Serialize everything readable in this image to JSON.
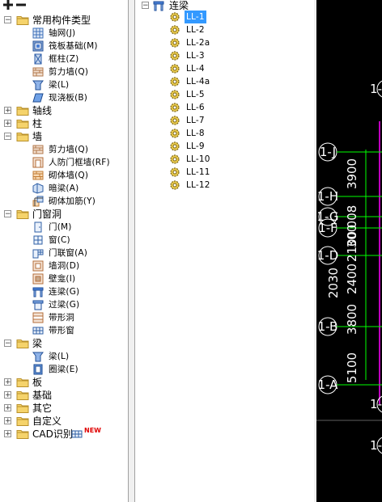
{
  "toolbar": {
    "add_icon": "plus-icon",
    "remove_icon": "minus-icon"
  },
  "left_tree": [
    {
      "label": "常用构件类型",
      "type": "group",
      "expanded": true,
      "children": [
        {
          "label": "轴网(J)",
          "icon": "axis-grid-icon"
        },
        {
          "label": "筏板基础(M)",
          "icon": "raft-foundation-icon"
        },
        {
          "label": "框柱(Z)",
          "icon": "frame-column-icon"
        },
        {
          "label": "剪力墙(Q)",
          "icon": "shear-wall-icon"
        },
        {
          "label": "梁(L)",
          "icon": "beam-icon"
        },
        {
          "label": "现浇板(B)",
          "icon": "slab-icon"
        }
      ]
    },
    {
      "label": "轴线",
      "type": "group",
      "expanded": false
    },
    {
      "label": "柱",
      "type": "group",
      "expanded": false
    },
    {
      "label": "墙",
      "type": "group",
      "expanded": true,
      "children": [
        {
          "label": "剪力墙(Q)",
          "icon": "shear-wall-icon"
        },
        {
          "label": "人防门框墙(RF)",
          "icon": "civil-defense-door-wall-icon"
        },
        {
          "label": "砌体墙(Q)",
          "icon": "masonry-wall-icon"
        },
        {
          "label": "暗梁(A)",
          "icon": "hidden-beam-icon"
        },
        {
          "label": "砌体加筋(Y)",
          "icon": "masonry-reinforcement-icon"
        }
      ]
    },
    {
      "label": "门窗洞",
      "type": "group",
      "expanded": true,
      "children": [
        {
          "label": "门(M)",
          "icon": "door-icon"
        },
        {
          "label": "窗(C)",
          "icon": "window-icon"
        },
        {
          "label": "门联窗(A)",
          "icon": "door-window-icon"
        },
        {
          "label": "墙洞(D)",
          "icon": "wall-opening-icon"
        },
        {
          "label": "壁龛(I)",
          "icon": "niche-icon"
        },
        {
          "label": "连梁(G)",
          "icon": "coupling-beam-icon"
        },
        {
          "label": "过梁(G)",
          "icon": "lintel-icon"
        },
        {
          "label": "带形洞",
          "icon": "strip-opening-icon"
        },
        {
          "label": "带形窗",
          "icon": "strip-window-icon"
        }
      ]
    },
    {
      "label": "梁",
      "type": "group",
      "expanded": true,
      "children": [
        {
          "label": "梁(L)",
          "icon": "beam-icon"
        },
        {
          "label": "圈梁(E)",
          "icon": "ring-beam-icon"
        }
      ]
    },
    {
      "label": "板",
      "type": "group",
      "expanded": false
    },
    {
      "label": "基础",
      "type": "group",
      "expanded": false
    },
    {
      "label": "其它",
      "type": "group",
      "expanded": false
    },
    {
      "label": "自定义",
      "type": "group",
      "expanded": false
    },
    {
      "label": "CAD识别",
      "type": "group",
      "expanded": false,
      "badge": "NEW"
    }
  ],
  "mid_tree": {
    "root_label": "连梁",
    "items": [
      "LL-1",
      "LL-2",
      "LL-2a",
      "LL-3",
      "LL-4",
      "LL-4a",
      "LL-5",
      "LL-6",
      "LL-7",
      "LL-8",
      "LL-9",
      "LL-10",
      "LL-11",
      "LL-12"
    ],
    "selected": "LL-1"
  },
  "cad_view": {
    "axis_labels": [
      "1-J",
      "1-H",
      "1-G",
      "1-F",
      "1-D",
      "1-B",
      "1-A"
    ],
    "dimensions": [
      "3900",
      "008",
      "300",
      "2100",
      "2400",
      "3800",
      "5100",
      "2030"
    ],
    "colors": {
      "background": "#000000",
      "dimension": "#ffffff",
      "grid_line": "#00ff00",
      "accent": "#ff00ff"
    }
  }
}
